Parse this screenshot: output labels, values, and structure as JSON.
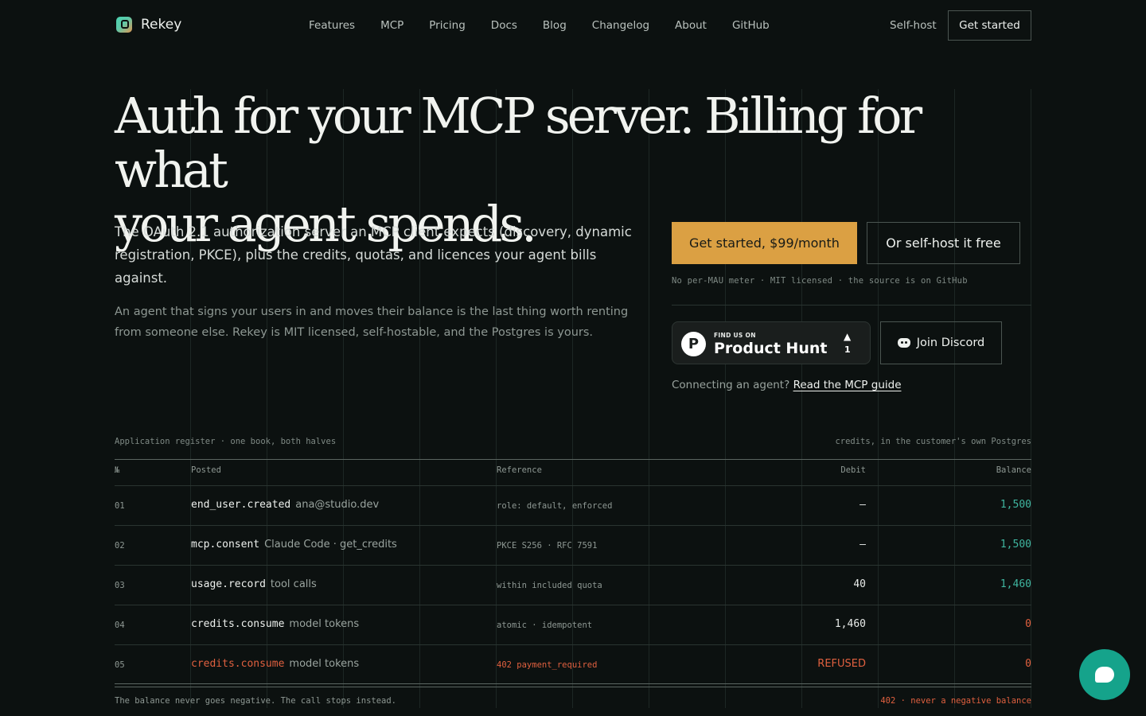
{
  "nav": {
    "brand": "Rekey",
    "links": [
      "Features",
      "MCP",
      "Pricing",
      "Docs",
      "Blog",
      "Changelog",
      "About",
      "GitHub"
    ],
    "selfhost": "Self-host",
    "cta": "Get started"
  },
  "hero": {
    "headline_line1": "Auth for your MCP server. Billing for what",
    "headline_line2": "your agent spends.",
    "lead": "The OAuth 2.1 authorization server an MCP client expects (discovery, dynamic registration, PKCE), plus the credits, quotas, and licences your agent bills against.",
    "sub": "An agent that signs your users in and moves their balance is the last thing worth renting from someone else. Rekey is MIT licensed, self-hostable, and the Postgres is yours.",
    "cta_primary": "Get started, $99/month",
    "cta_secondary": "Or self-host it free",
    "meta": "No per-MAU meter · MIT licensed · the source is on GitHub",
    "producthunt": {
      "small": "FIND US ON",
      "big": "Product Hunt",
      "count": "1",
      "logo": "P"
    },
    "discord": "Join Discord",
    "guide_prefix": "Connecting an agent?",
    "guide_link": "Read the MCP guide"
  },
  "ledger": {
    "caption_left": "Application register · one book, both halves",
    "caption_right": "credits, in the customer's own Postgres",
    "headers": {
      "num": "№",
      "posted": "Posted",
      "reference": "Reference",
      "debit": "Debit",
      "balance": "Balance"
    },
    "rows": [
      {
        "num": "01",
        "event": "end_user.created",
        "detail": "ana@studio.dev",
        "reference": "role: default, enforced",
        "debit": "–",
        "balance": "1,500"
      },
      {
        "num": "02",
        "event": "mcp.consent",
        "detail": "Claude Code · get_credits",
        "reference": "PKCE S256 · RFC 7591",
        "debit": "–",
        "balance": "1,500"
      },
      {
        "num": "03",
        "event": "usage.record",
        "detail": "tool calls",
        "reference": "within included quota",
        "debit": "40",
        "balance": "1,460"
      },
      {
        "num": "04",
        "event": "credits.consume",
        "detail": "model tokens",
        "reference": "atomic · idempotent",
        "debit": "1,460",
        "balance": "0"
      },
      {
        "num": "05",
        "event": "credits.consume",
        "detail": "model tokens",
        "reference": "402 payment_required",
        "debit": "REFUSED",
        "balance": "0"
      }
    ],
    "footer_left": "The balance never goes negative. The call stops instead.",
    "footer_right": "402 · never a negative balance"
  },
  "colors": {
    "accent": "#dba043",
    "teal": "#3fb6a0",
    "error": "#e0603f",
    "chat": "#15a38b"
  },
  "icons": {
    "chat": "chat-bubble-icon",
    "discord": "discord-icon",
    "logo": "rekey-logo-icon"
  }
}
